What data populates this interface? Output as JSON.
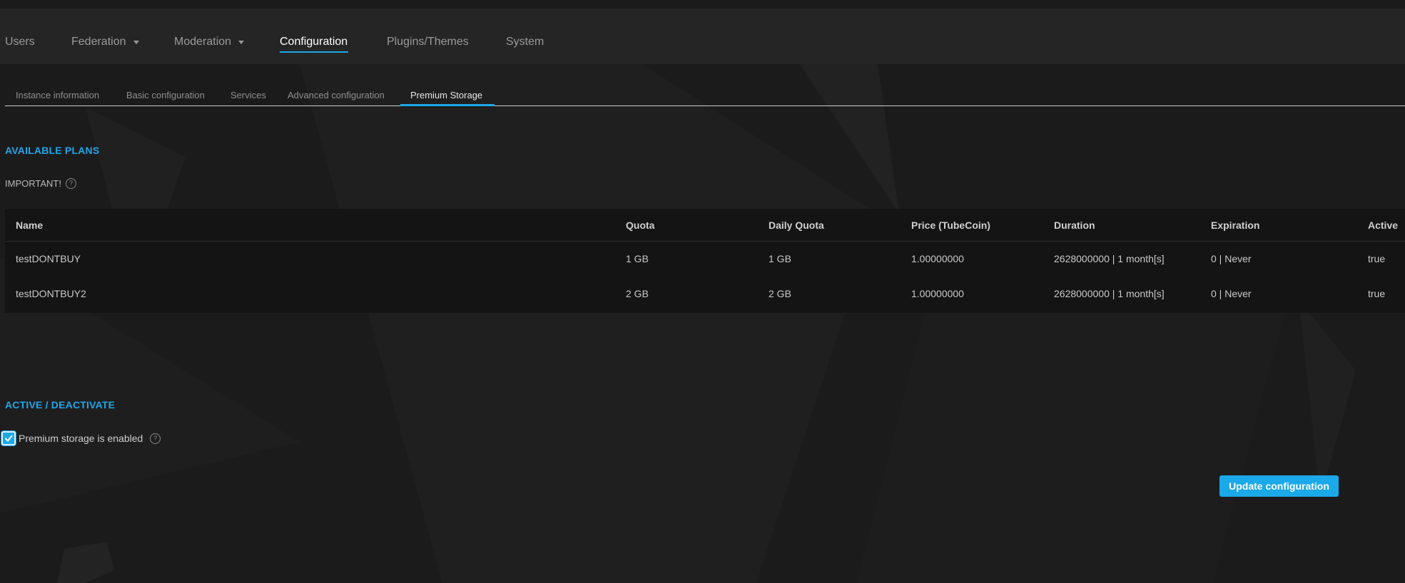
{
  "topnav": {
    "items": [
      {
        "label": "Users"
      },
      {
        "label": "Federation"
      },
      {
        "label": "Moderation"
      },
      {
        "label": "Configuration"
      },
      {
        "label": "Plugins/Themes"
      },
      {
        "label": "System"
      }
    ]
  },
  "subtabs": [
    {
      "label": "Instance information"
    },
    {
      "label": "Basic configuration"
    },
    {
      "label": "Services"
    },
    {
      "label": "Advanced configuration"
    },
    {
      "label": "Premium Storage"
    }
  ],
  "plans": {
    "title": "AVAILABLE PLANS",
    "important": "IMPORTANT!",
    "help_glyph": "?",
    "columns": [
      "Name",
      "Quota",
      "Daily Quota",
      "Price (TubeCoin)",
      "Duration",
      "Expiration",
      "Active"
    ],
    "rows": [
      [
        "testDONTBUY",
        "1 GB",
        "1 GB",
        "1.00000000",
        "2628000000 | 1 month[s]",
        "0 | Never",
        "true"
      ],
      [
        "testDONTBUY2",
        "2 GB",
        "2 GB",
        "1.00000000",
        "2628000000 | 1 month[s]",
        "0 | Never",
        "true"
      ]
    ]
  },
  "activation": {
    "title": "ACTIVE / DEACTIVATE",
    "checkbox_label": "Premium storage is enabled",
    "checked": true,
    "help_glyph": "?"
  },
  "actions": {
    "update_label": "Update configuration"
  },
  "colors": {
    "accent": "#1ba9e9",
    "background": "#1b1b1c",
    "nav_background": "#252526"
  }
}
